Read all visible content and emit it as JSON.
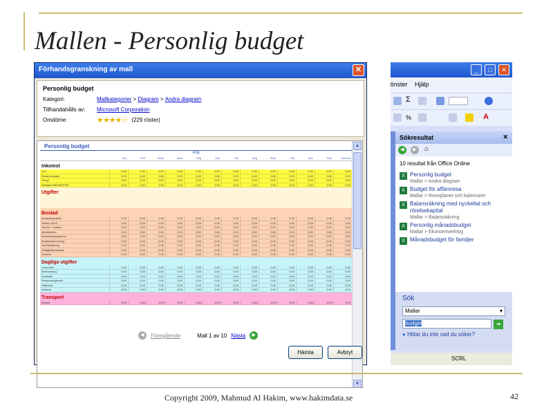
{
  "slide": {
    "title": "Mallen  - Personlig budget",
    "footer": "Copyright 2009, Mahmud Al Hakim, www.hakimdata.se",
    "page_number": "42"
  },
  "dialog": {
    "title": "Förhandsgranskning av mall",
    "template_title": "Personlig budget",
    "category_label": "Kategori:",
    "category_path": [
      "Mallkategorier",
      "Diagram",
      "Andra diagram"
    ],
    "provider_label": "Tillhandahålls av:",
    "provider": "Microsoft Corporation",
    "rating_label": "Omdöme:",
    "rating_stars": 4,
    "rating_votes": "(229 röster)",
    "nav_prev": "Föregående",
    "nav_position": "Mall 1 av 10",
    "nav_next": "Nästa",
    "download_button": "Hämta",
    "cancel_button": "Avbryt"
  },
  "preview": {
    "sheet_title": "Personlig budget",
    "year_label": "Årlig",
    "months": [
      "Jan",
      "Feb",
      "Mars",
      "April",
      "Maj",
      "Juni",
      "Juli",
      "Aug",
      "Sept",
      "Okt",
      "Nov",
      "Dec",
      "Summa"
    ],
    "sections": [
      {
        "heading": "Inkomst",
        "color": "#fffb43",
        "rows": [
          "Lön",
          "Extrainkomster",
          "Övrigt",
          "SUMMA INKOMSTER"
        ]
      },
      {
        "heading": "Utgifter",
        "color": "#fff6d9",
        "rows": []
      },
      {
        "heading": "Bostad",
        "color": "#fdd3b5",
        "rows": [
          "Bostadshyra/lån",
          "Vatten och el",
          "Telefon - bostad",
          "Mobiltelefon",
          "Bostadsreparationer",
          "Bostadsrenovering",
          "Hemförsäkring",
          "Trädgårdsmaterial",
          "Summa"
        ]
      },
      {
        "heading": "Dagliga utgifter",
        "color": "#c7f4f9",
        "rows": [
          "Livsmedel",
          "Barnomsorg",
          "Kemtvätt",
          "Restaurangbesök",
          "Städning",
          "Summa"
        ]
      },
      {
        "heading": "Transport",
        "color": "#fdb2dc",
        "rows": [
          "Bensin"
        ]
      }
    ],
    "cell_value": "0,00"
  },
  "pane": {
    "menu": [
      "fönster",
      "Hjälp"
    ],
    "search_results_title": "Sökresultat",
    "results_count": "10 resultat från Office Online",
    "results": [
      {
        "title": "Personlig budget",
        "sub": "Mallar > Andra diagram"
      },
      {
        "title": "Budget för affärsresa",
        "sub": "Mallar > Reseplaner och kalenrarer"
      },
      {
        "title": "Balansräkning med nyckeltal och rörelsekapital",
        "sub": "Mallar > Balansräkning"
      },
      {
        "title": "Personlig månadsbudget",
        "sub": "Mallar > Ekonomiverktyg"
      },
      {
        "title": "Månadsbudget för familjer",
        "sub": ""
      }
    ],
    "search_heading": "Sök",
    "search_scope": "Mallar",
    "search_value": "budget",
    "help_link": "Hittar du inte vad du söker?",
    "status": "SCRL"
  }
}
